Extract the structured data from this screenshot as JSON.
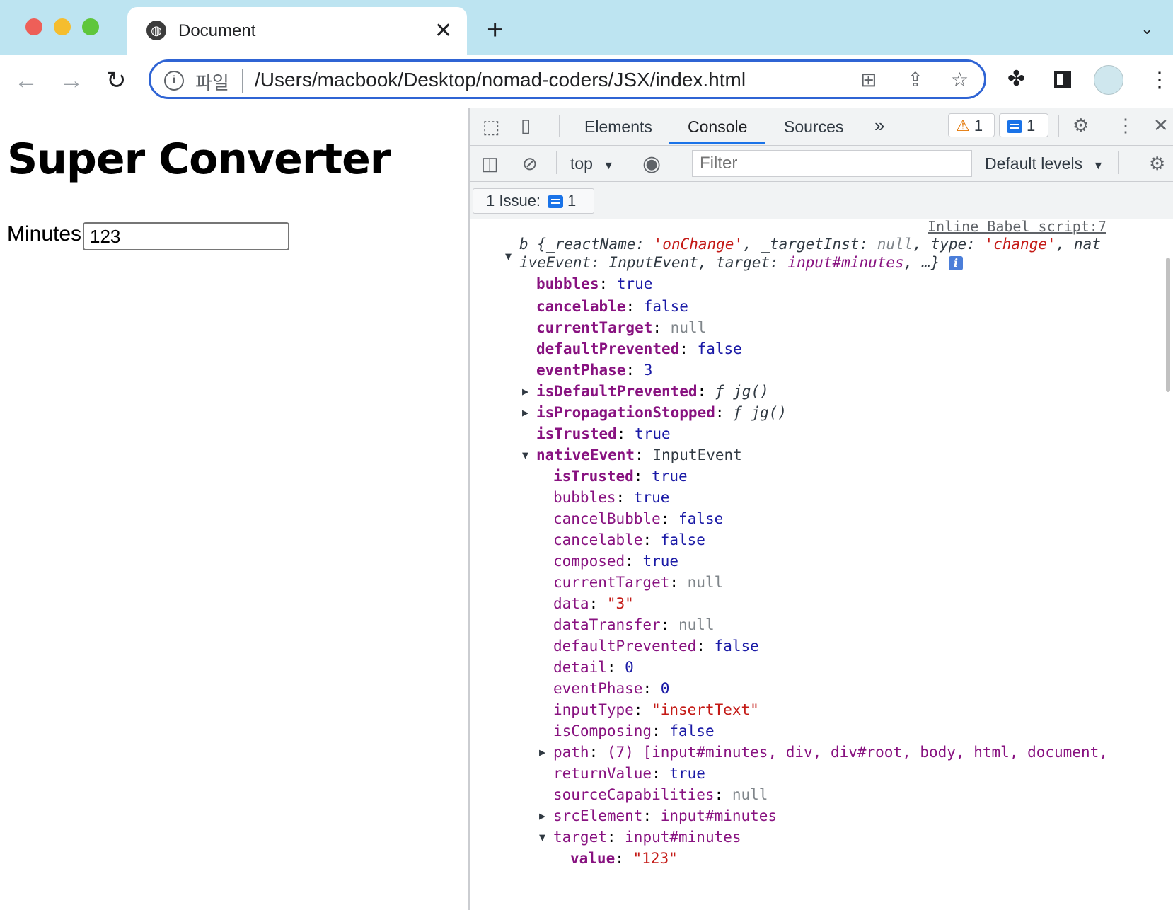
{
  "browser": {
    "tab_title": "Document",
    "close_glyph": "✕",
    "newtab_glyph": "+",
    "scheme_label": "파일",
    "url": "/Users/macbook/Desktop/nomad-coders/JSX/index.html",
    "traffic_lights": [
      "#ee5f58",
      "#f5bd2e",
      "#5fc63c"
    ]
  },
  "page": {
    "title": "Super Converter",
    "minutes_label": "Minutes",
    "minutes_value": "123"
  },
  "devtools": {
    "tabs": [
      "Elements",
      "Console",
      "Sources"
    ],
    "active_tab": "Console",
    "more_tabs": "»",
    "warn_count": "1",
    "info_count": "1",
    "context": "top",
    "filter_placeholder": "Filter",
    "levels": "Default levels",
    "issues_label": "1 Issue:",
    "issues_count": "1"
  },
  "console": {
    "source_link": "Inline Babel script:7",
    "header_line1": "b {_reactName: 'onChange', _targetInst: null, type: 'change', nat",
    "header_line2": "iveEvent: InputEvent, target: input#minutes, …}",
    "rows": [
      {
        "key": "bubbles",
        "value": "true"
      },
      {
        "key": "cancelable",
        "value": "false"
      },
      {
        "key": "currentTarget",
        "value": "null"
      },
      {
        "key": "defaultPrevented",
        "value": "false"
      },
      {
        "key": "eventPhase",
        "value": "3"
      },
      {
        "key": "isDefaultPrevented",
        "value": "ƒ jg()"
      },
      {
        "key": "isPropagationStopped",
        "value": "ƒ jg()"
      },
      {
        "key": "isTrusted",
        "value": "true"
      },
      {
        "key": "nativeEvent",
        "value": "InputEvent"
      },
      {
        "key": "isTrusted",
        "value": "true"
      },
      {
        "key": "bubbles",
        "value": "true"
      },
      {
        "key": "cancelBubble",
        "value": "false"
      },
      {
        "key": "cancelable",
        "value": "false"
      },
      {
        "key": "composed",
        "value": "true"
      },
      {
        "key": "currentTarget",
        "value": "null"
      },
      {
        "key": "data",
        "value": "\"3\""
      },
      {
        "key": "dataTransfer",
        "value": "null"
      },
      {
        "key": "defaultPrevented",
        "value": "false"
      },
      {
        "key": "detail",
        "value": "0"
      },
      {
        "key": "eventPhase",
        "value": "0"
      },
      {
        "key": "inputType",
        "value": "\"insertText\""
      },
      {
        "key": "isComposing",
        "value": "false"
      },
      {
        "key": "path",
        "value": "(7) [input#minutes, div, div#root, body, html, document,"
      },
      {
        "key": "returnValue",
        "value": "true"
      },
      {
        "key": "sourceCapabilities",
        "value": "null"
      },
      {
        "key": "srcElement",
        "value": "input#minutes"
      },
      {
        "key": "target",
        "value": "input#minutes"
      },
      {
        "key": "value",
        "value": "\"123\""
      }
    ]
  }
}
